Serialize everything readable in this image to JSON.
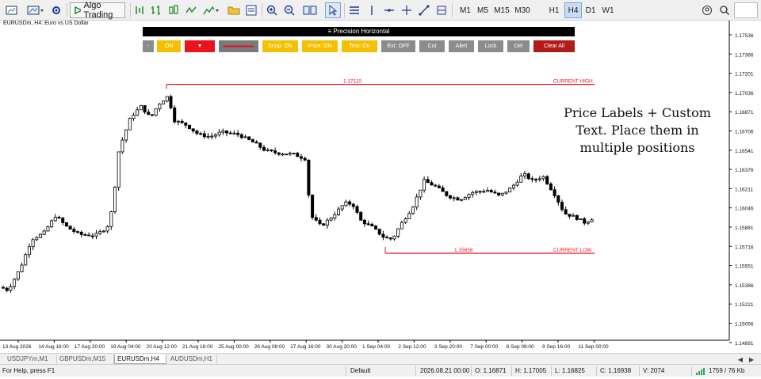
{
  "toolbar": {
    "algo_label": "Algo Trading",
    "timeframes": [
      "M1",
      "M5",
      "M15",
      "M30",
      "H1",
      "H4",
      "D1",
      "W1"
    ],
    "active_timeframe": "H4"
  },
  "chart": {
    "symbol_label": "EURUSDm, H4:  Euro vs US Dollar",
    "price_ticks": [
      "1.17536",
      "1.17366",
      "1.17201",
      "1.17036",
      "1.16871",
      "1.16706",
      "1.16541",
      "1.16376",
      "1.16211",
      "1.16046",
      "1.15881",
      "1.15716",
      "1.15551",
      "1.15386",
      "1.15221",
      "1.15056",
      "1.14891"
    ],
    "time_ticks": [
      "13 Aug 2026",
      "14 Aug 16:00",
      "17 Aug 20:00",
      "19 Aug 04:00",
      "20 Aug 12:00",
      "21 Aug 16:00",
      "25 Aug 00:00",
      "26 Aug 08:00",
      "27 Aug 16:00",
      "30 Aug 20:00",
      "1 Sep 04:00",
      "2 Sep 12:00",
      "3 Sep 20:00",
      "7 Sep 00:00",
      "8 Sep 08:00",
      "9 Sep 16:00",
      "11 Sep 00:00"
    ],
    "high_line": {
      "price": "1.17110",
      "label": "CURRENT HIGH"
    },
    "low_line": {
      "price": "1.15658",
      "label": "CURRENT LOW"
    },
    "line_color": "#e8131b"
  },
  "panel": {
    "title": "≡  Precision Horizontal",
    "buttons": [
      {
        "label": "-",
        "bg": "#8c8c8c"
      },
      {
        "label": "ON",
        "bg": "#f5c000"
      },
      {
        "label": "▼",
        "bg": "#e8131b"
      },
      {
        "label": "",
        "bg": "#7a7a7a"
      },
      {
        "label": "Snap: ON",
        "bg": "#f5c000"
      },
      {
        "label": "Price: ON",
        "bg": "#f5c000"
      },
      {
        "label": "Text: On",
        "bg": "#f5c000"
      },
      {
        "label": "Ext: OFF",
        "bg": "#8c8c8c"
      },
      {
        "label": "Cut",
        "bg": "#8c8c8c"
      },
      {
        "label": "Alert",
        "bg": "#8c8c8c"
      },
      {
        "label": "Lock",
        "bg": "#8c8c8c"
      },
      {
        "label": "Del",
        "bg": "#8c8c8c"
      },
      {
        "label": "Clear All",
        "bg": "#b31b1b"
      }
    ]
  },
  "annotation": {
    "line1": "Price Labels + Custom",
    "line2": "Text. Place them in",
    "line3": "multiple positions"
  },
  "tabs": [
    "USDJPYm,M1",
    "GBPUSDm,M15",
    "EURUSDm,H4",
    "AUDUSDm,H1"
  ],
  "active_tab": "EURUSDm,H4",
  "status": {
    "help": "For Help, press F1",
    "profile": "Default",
    "datetime": "2026.08.21 00:00",
    "open": "O: 1.16871",
    "high": "H: 1.17005",
    "low": "L: 1.16825",
    "close": "C: 1.16938",
    "volume": "V: 2074",
    "traffic": "1759 / 76 Kb"
  },
  "colors": {
    "bull": "#ffffff",
    "bear": "#000000",
    "accent": "#e8131b"
  }
}
